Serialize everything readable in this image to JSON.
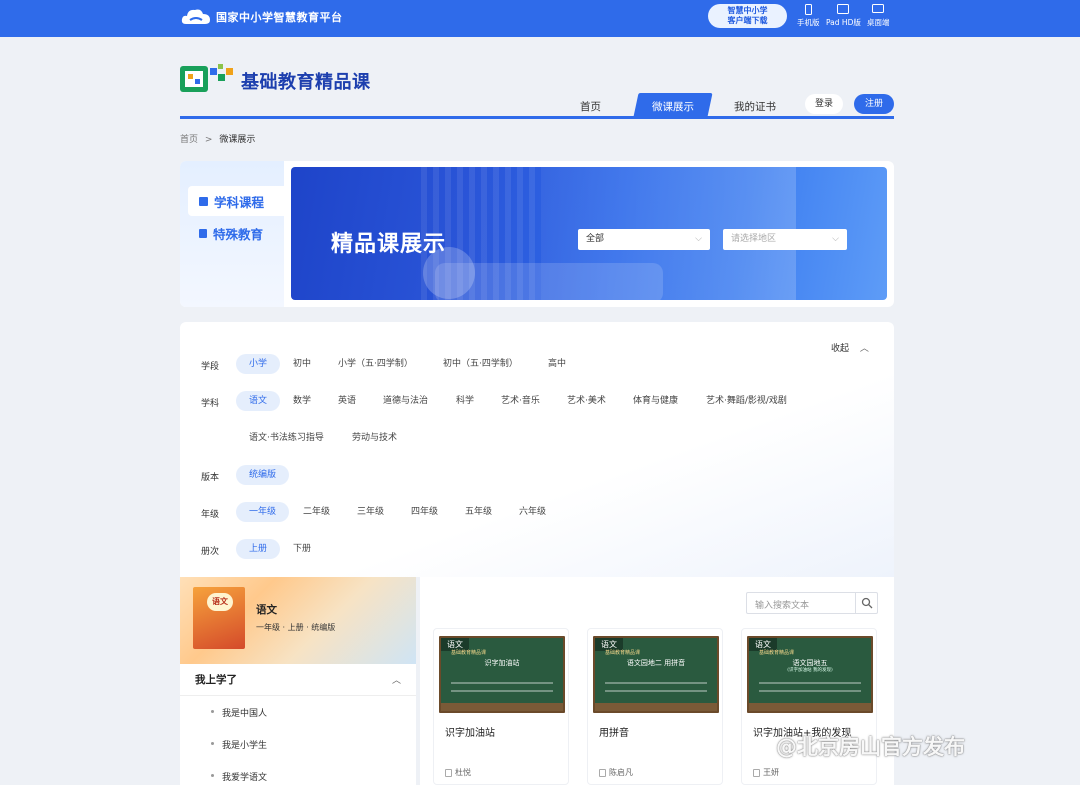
{
  "topbar": {
    "platform_name": "国家中小学智慧教育平台",
    "download_line1": "智慧中小学",
    "download_line2": "客户端下载",
    "devices": [
      "手机版",
      "Pad HD版",
      "桌面端"
    ],
    "color": "#2f6bea"
  },
  "brand": {
    "title": "基础教育精品课"
  },
  "nav": {
    "items": [
      "首页",
      "微课展示",
      "我的证书"
    ],
    "active": "微课展示",
    "login": "登录",
    "register": "注册"
  },
  "breadcrumb": {
    "home": "首页",
    "sep": ">",
    "current": "微课展示"
  },
  "side_tabs": [
    {
      "label": "学科课程",
      "active": true
    },
    {
      "label": "特殊教育",
      "active": false
    }
  ],
  "banner": {
    "title": "精品课展示",
    "select1_value": "全部",
    "select2_placeholder": "请选择地区"
  },
  "filters": {
    "collapse_label": "收起",
    "rows": [
      {
        "label": "学段",
        "options": [
          "小学",
          "初中",
          "小学（五·四学制）",
          "初中（五·四学制）",
          "高中"
        ],
        "selected": 0
      },
      {
        "label": "学科",
        "options": [
          "语文",
          "数学",
          "英语",
          "道德与法治",
          "科学",
          "艺术·音乐",
          "艺术·美术",
          "体育与健康",
          "艺术·舞蹈/影视/戏剧",
          "语文·书法练习指导",
          "劳动与技术"
        ],
        "selected": 0
      },
      {
        "label": "版本",
        "options": [
          "统编版"
        ],
        "selected": 0
      },
      {
        "label": "年级",
        "options": [
          "一年级",
          "二年级",
          "三年级",
          "四年级",
          "五年级",
          "六年级"
        ],
        "selected": 0
      },
      {
        "label": "册次",
        "options": [
          "上册",
          "下册"
        ],
        "selected": 0
      }
    ]
  },
  "course": {
    "book_badge": "语文",
    "name": "语文",
    "meta": "一年级 · 上册 · 统编版",
    "section_title": "我上学了",
    "lessons": [
      "我是中国人",
      "我是小学生",
      "我爱学语文"
    ]
  },
  "results": {
    "search_placeholder": "输入搜索文本",
    "videos": [
      {
        "tag": "语文",
        "thumb_sup": "基础教育精品课",
        "thumb_title": "识字加油站",
        "thumb_sub": "",
        "title": "识字加油站",
        "author": "杜悦"
      },
      {
        "tag": "语文",
        "thumb_sup": "基础教育精品课",
        "thumb_title": "语文园地二 用拼音",
        "thumb_sub": "",
        "title": "用拼音",
        "author": "陈启凡"
      },
      {
        "tag": "语文",
        "thumb_sup": "基础教育精品课",
        "thumb_title": "语文园地五",
        "thumb_sub": "(识字加油站 我的发现)",
        "title": "识字加油站+我的发现",
        "author": "王妍"
      }
    ]
  },
  "watermark": "@北京房山官方发布"
}
